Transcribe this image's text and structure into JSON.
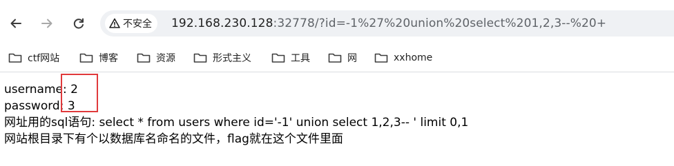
{
  "browser": {
    "security_label": "不安全",
    "url_host": "192.168.230.128",
    "url_rest": ":32778/?id=-1%27%20union%20select%201,2,3--%20+",
    "nav": {
      "back_icon": "arrow-left-icon",
      "forward_icon": "arrow-right-icon",
      "reload_icon": "reload-icon"
    }
  },
  "bookmarks": [
    {
      "label": "ctf网站"
    },
    {
      "label": "博客"
    },
    {
      "label": "资源"
    },
    {
      "label": "形式主义"
    },
    {
      "label": "工具"
    },
    {
      "label": "网"
    },
    {
      "label": "xxhome"
    }
  ],
  "page": {
    "line1": "username: 2",
    "line2": "password: 3",
    "line3": "网址用的sql语句: select * from users where id='-1' union select 1,2,3-- ' limit 0,1",
    "line4": "网站根目录下有个以数据库名命名的文件，flag就在这个文件里面"
  },
  "colors": {
    "highlight_box": "#e0393b",
    "omnibox_bg": "#eff1f4"
  }
}
